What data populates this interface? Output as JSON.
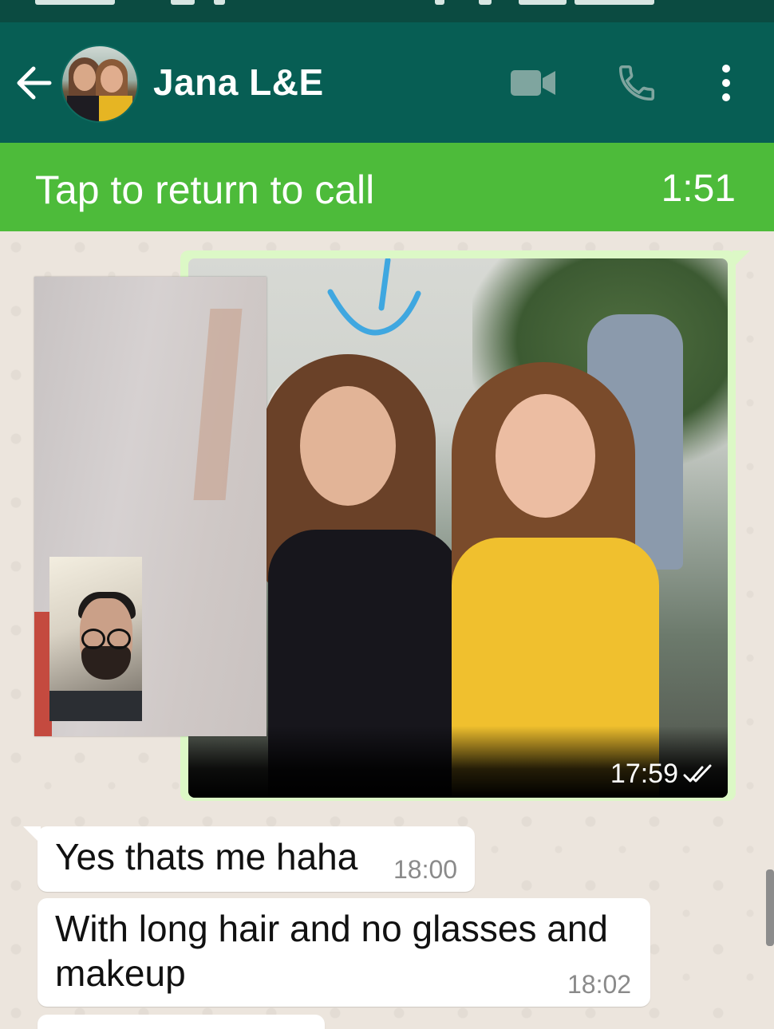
{
  "header": {
    "contact_name": "Jana L&E",
    "back_icon": "arrow-left-icon",
    "video_icon": "video-camera-icon",
    "call_icon": "phone-icon",
    "menu_icon": "more-vertical-icon",
    "color": "#075e54"
  },
  "call_banner": {
    "text": "Tap to return to call",
    "timer": "1:51",
    "color": "#4dbb3a"
  },
  "messages": [
    {
      "type": "image",
      "time": "17:59",
      "status_icon": "double-check-icon",
      "direction": "outgoing"
    },
    {
      "type": "text",
      "text": "Yes thats me haha",
      "time": "18:00",
      "direction": "incoming"
    },
    {
      "type": "text",
      "text": "With long hair and no glasses and makeup",
      "time": "18:02",
      "direction": "incoming"
    }
  ],
  "colors": {
    "chat_background": "#ece5dd",
    "outgoing_bubble": "#dcf8c6",
    "incoming_bubble": "#ffffff"
  }
}
